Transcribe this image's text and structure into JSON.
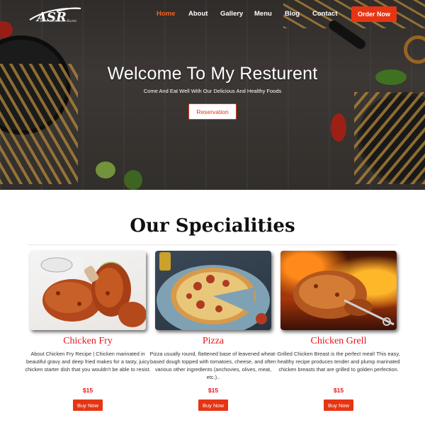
{
  "brand": {
    "logo_text": "ASR",
    "logo_tagline": "Suni Rahman Rumi",
    "accent": "#e53514",
    "active_nav": "#f26522"
  },
  "nav": {
    "items": [
      {
        "label": "Home",
        "active": true
      },
      {
        "label": "About",
        "active": false
      },
      {
        "label": "Gallery",
        "active": false
      },
      {
        "label": "Menu",
        "active": false
      },
      {
        "label": "Blog",
        "active": false
      },
      {
        "label": "Contact",
        "active": false
      }
    ],
    "order_label": "Order Now"
  },
  "hero": {
    "title": "Welcome To My Resturent",
    "subtitle": "Come And Eat Well With Our Delicious And Healthy Foods",
    "reservation_label": "Reservation"
  },
  "specialities": {
    "title": "Our Specialities",
    "cards": [
      {
        "name": "Chicken Fry",
        "image_icon": "fried-chicken-image",
        "description": "About Chicken Fry Recipe | Chicken marinated in beautiful gravy and deep fried makes for a tasty, juicy chicken starter dish that you wouldn't be able to resist.",
        "price": "$15",
        "buy_label": "Buy Now"
      },
      {
        "name": "Pizza",
        "image_icon": "pizza-image",
        "description": "Pizza usually round, flattened base of leavened wheat-based dough topped with tomatoes, cheese, and often various other ingredients (anchovies, olives, meat, etc.)..",
        "price": "$15",
        "buy_label": "Buy Now"
      },
      {
        "name": "Chicken Grell",
        "image_icon": "grilled-chicken-image",
        "description": "Grilled Chicken Breast is the perfect meal! This easy, healthy recipe produces tender and plump marinated chicken breasts that are grilled to golden perfection.",
        "price": "$15",
        "buy_label": "Buy Now"
      }
    ]
  }
}
